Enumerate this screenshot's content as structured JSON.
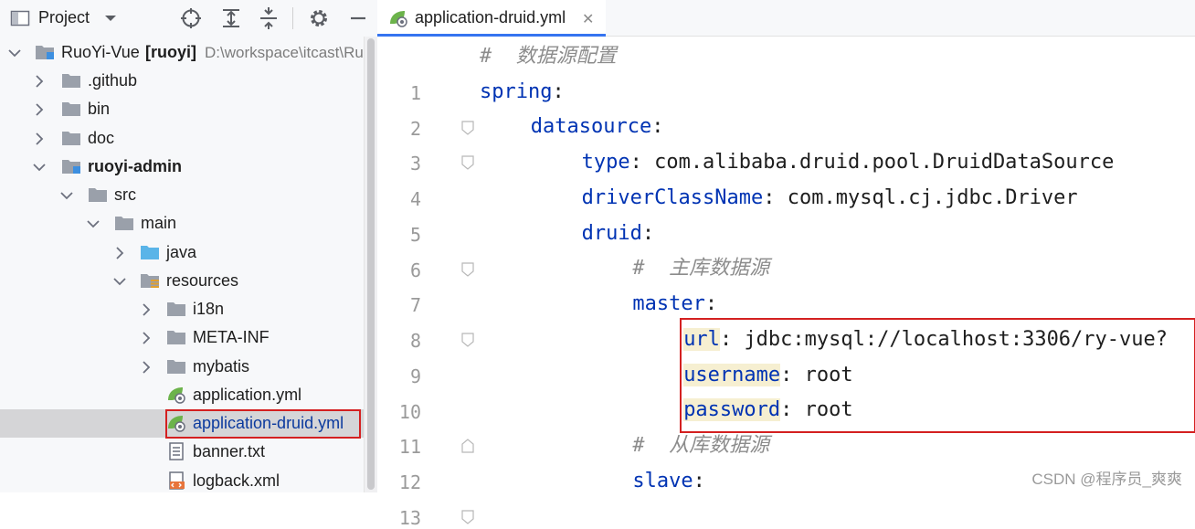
{
  "project_panel": {
    "title": "Project",
    "toolbar_icons": [
      "dropdown-arrow-icon",
      "locate-icon",
      "expand-all-icon",
      "collapse-all-icon",
      "settings-gear-icon",
      "hide-minus-icon"
    ],
    "root": {
      "name": "RuoYi-Vue",
      "module": "[ruoyi]",
      "path": "D:\\workspace\\itcast\\Ru"
    },
    "items": [
      {
        "label": ".github"
      },
      {
        "label": "bin"
      },
      {
        "label": "doc"
      },
      {
        "label": "ruoyi-admin"
      },
      {
        "label": "src"
      },
      {
        "label": "main"
      },
      {
        "label": "java"
      },
      {
        "label": "resources"
      },
      {
        "label": "i18n"
      },
      {
        "label": "META-INF"
      },
      {
        "label": "mybatis"
      },
      {
        "label": "application.yml"
      },
      {
        "label": "application-druid.yml"
      },
      {
        "label": "banner.txt"
      },
      {
        "label": "logback.xml"
      }
    ]
  },
  "editor": {
    "tab": {
      "label": "application-druid.yml",
      "close": "✕"
    },
    "line_numbers": [
      "1",
      "2",
      "3",
      "4",
      "5",
      "6",
      "7",
      "8",
      "9",
      "10",
      "11",
      "12",
      "13"
    ],
    "lines": [
      {
        "comment": "#  数据源配置"
      },
      {
        "key": "spring",
        "sep": ":"
      },
      {
        "key": "datasource",
        "sep": ":"
      },
      {
        "key": "type",
        "sep": ": ",
        "value": "com.alibaba.druid.pool.DruidDataSource"
      },
      {
        "key": "driverClassName",
        "sep": ": ",
        "value": "com.mysql.cj.jdbc.Driver"
      },
      {
        "key": "druid",
        "sep": ":"
      },
      {
        "comment": "#  主库数据源"
      },
      {
        "key": "master",
        "sep": ":"
      },
      {
        "key": "url",
        "sep": ": ",
        "value": "jdbc:mysql://localhost:3306/ry-vue?"
      },
      {
        "key": "username",
        "sep": ": ",
        "value": "root"
      },
      {
        "key": "password",
        "sep": ": ",
        "value": "root"
      },
      {
        "comment": "#  从库数据源"
      },
      {
        "key": "slave",
        "sep": ":"
      }
    ]
  },
  "watermark": "CSDN @程序员_爽爽"
}
